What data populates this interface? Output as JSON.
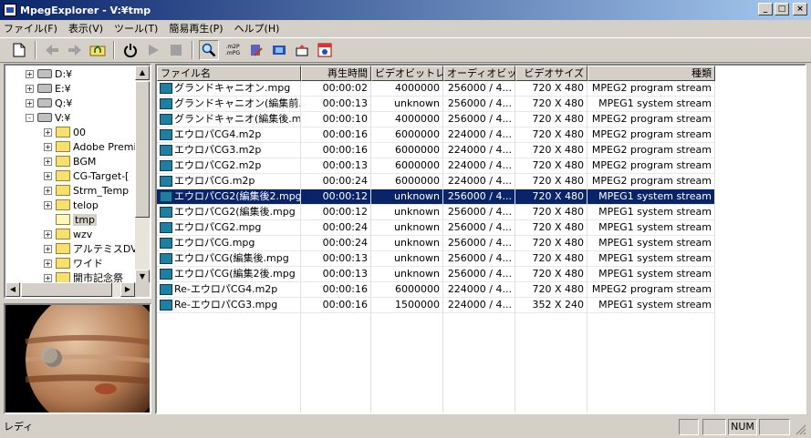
{
  "window": {
    "title": "MpegExplorer - V:¥tmp"
  },
  "window_buttons": {
    "minimize": "_",
    "maximize": "□",
    "close": "×"
  },
  "menu": [
    "ファイル(F)",
    "表示(V)",
    "ツール(T)",
    "簡易再生(P)",
    "ヘルプ(H)"
  ],
  "toolbar": {
    "icons": [
      "new-file-icon",
      "back-arrow-icon",
      "forward-arrow-icon",
      "folder-up-icon",
      "power-icon",
      "play-icon",
      "stop-icon",
      "search-icon",
      "m2p-to-mpg-icon",
      "wrench-icon",
      "film-settings-icon",
      "save-icon",
      "calendar-icon"
    ],
    "convert_label_top": ".m2P",
    "convert_label_bottom": ".mPG"
  },
  "tree": [
    {
      "label": "D:¥",
      "type": "drive",
      "exp": "+",
      "indent": 0
    },
    {
      "label": "E:¥",
      "type": "drive",
      "exp": "+",
      "indent": 0
    },
    {
      "label": "Q:¥",
      "type": "drive",
      "exp": "+",
      "indent": 0
    },
    {
      "label": "V:¥",
      "type": "drive",
      "exp": "-",
      "indent": 0
    },
    {
      "label": "00",
      "type": "folder",
      "exp": "+",
      "indent": 1
    },
    {
      "label": "Adobe Premi",
      "type": "folder",
      "exp": "+",
      "indent": 1
    },
    {
      "label": "BGM",
      "type": "folder",
      "exp": "+",
      "indent": 1
    },
    {
      "label": "CG-Target-[",
      "type": "folder",
      "exp": "+",
      "indent": 1
    },
    {
      "label": "Strm_Temp",
      "type": "folder",
      "exp": "+",
      "indent": 1
    },
    {
      "label": "telop",
      "type": "folder",
      "exp": "+",
      "indent": 1
    },
    {
      "label": "tmp",
      "type": "folder-open",
      "exp": "",
      "indent": 1
    },
    {
      "label": "wzv",
      "type": "folder",
      "exp": "+",
      "indent": 1
    },
    {
      "label": "アルテミスDV",
      "type": "folder",
      "exp": "+",
      "indent": 1
    },
    {
      "label": "ワイド",
      "type": "folder",
      "exp": "+",
      "indent": 1
    },
    {
      "label": "開市記念祭",
      "type": "folder",
      "exp": "+",
      "indent": 1
    }
  ],
  "scroll_arrows": {
    "up": "▲",
    "down": "▼",
    "left": "◀",
    "right": "▶"
  },
  "columns": [
    "ファイル名",
    "再生時間",
    "ビデオビットレ...",
    "オーディオビッ...",
    "ビデオサイズ",
    "種類"
  ],
  "files": [
    {
      "name": "グランドキャニオン.mpg",
      "time": "00:00:02",
      "vbr": "4000000",
      "abr": "256000 / 4...",
      "size": "720 X 480",
      "kind": "MPEG2 program stream"
    },
    {
      "name": "グランドキャニオン(編集前...",
      "time": "00:00:13",
      "vbr": "unknown",
      "abr": "256000 / 4...",
      "size": "720 X 480",
      "kind": "MPEG1 system stream"
    },
    {
      "name": "グランドキャニオ(編集後.mpg",
      "time": "00:00:10",
      "vbr": "4000000",
      "abr": "256000 / 4...",
      "size": "720 X 480",
      "kind": "MPEG2 program stream"
    },
    {
      "name": "エウロパCG4.m2p",
      "time": "00:00:16",
      "vbr": "6000000",
      "abr": "224000 / 4...",
      "size": "720 X 480",
      "kind": "MPEG2 program stream"
    },
    {
      "name": "エウロパCG3.m2p",
      "time": "00:00:16",
      "vbr": "6000000",
      "abr": "224000 / 4...",
      "size": "720 X 480",
      "kind": "MPEG2 program stream"
    },
    {
      "name": "エウロパCG2.m2p",
      "time": "00:00:13",
      "vbr": "6000000",
      "abr": "224000 / 4...",
      "size": "720 X 480",
      "kind": "MPEG2 program stream"
    },
    {
      "name": "エウロパCG.m2p",
      "time": "00:00:24",
      "vbr": "6000000",
      "abr": "224000 / 4...",
      "size": "720 X 480",
      "kind": "MPEG2 program stream"
    },
    {
      "name": "エウロパCG2(編集後2.mpg",
      "time": "00:00:12",
      "vbr": "unknown",
      "abr": "256000 / 4...",
      "size": "720 X 480",
      "kind": "MPEG1 system stream",
      "selected": true
    },
    {
      "name": "エウロパCG2(編集後.mpg",
      "time": "00:00:12",
      "vbr": "unknown",
      "abr": "256000 / 4...",
      "size": "720 X 480",
      "kind": "MPEG1 system stream"
    },
    {
      "name": "エウロパCG2.mpg",
      "time": "00:00:24",
      "vbr": "unknown",
      "abr": "256000 / 4...",
      "size": "720 X 480",
      "kind": "MPEG1 system stream"
    },
    {
      "name": "エウロパCG.mpg",
      "time": "00:00:24",
      "vbr": "unknown",
      "abr": "256000 / 4...",
      "size": "720 X 480",
      "kind": "MPEG1 system stream"
    },
    {
      "name": "エウロパCG(編集後.mpg",
      "time": "00:00:13",
      "vbr": "unknown",
      "abr": "256000 / 4...",
      "size": "720 X 480",
      "kind": "MPEG1 system stream"
    },
    {
      "name": "エウロパCG(編集2後.mpg",
      "time": "00:00:13",
      "vbr": "unknown",
      "abr": "256000 / 4...",
      "size": "720 X 480",
      "kind": "MPEG1 system stream"
    },
    {
      "name": "Re-エウロパCG4.m2p",
      "time": "00:00:16",
      "vbr": "6000000",
      "abr": "224000 / 4...",
      "size": "720 X 480",
      "kind": "MPEG2 program stream"
    },
    {
      "name": "Re-エウロパCG3.mpg",
      "time": "00:00:16",
      "vbr": "1500000",
      "abr": "224000 / 4...",
      "size": "352 X 240",
      "kind": "MPEG1 system stream"
    }
  ],
  "status": {
    "text": "レディ",
    "num": "NUM"
  },
  "colors": {
    "selection": "#0a246a",
    "title_start": "#0a246a",
    "title_end": "#a6caf0",
    "face": "#d4d0c8"
  }
}
